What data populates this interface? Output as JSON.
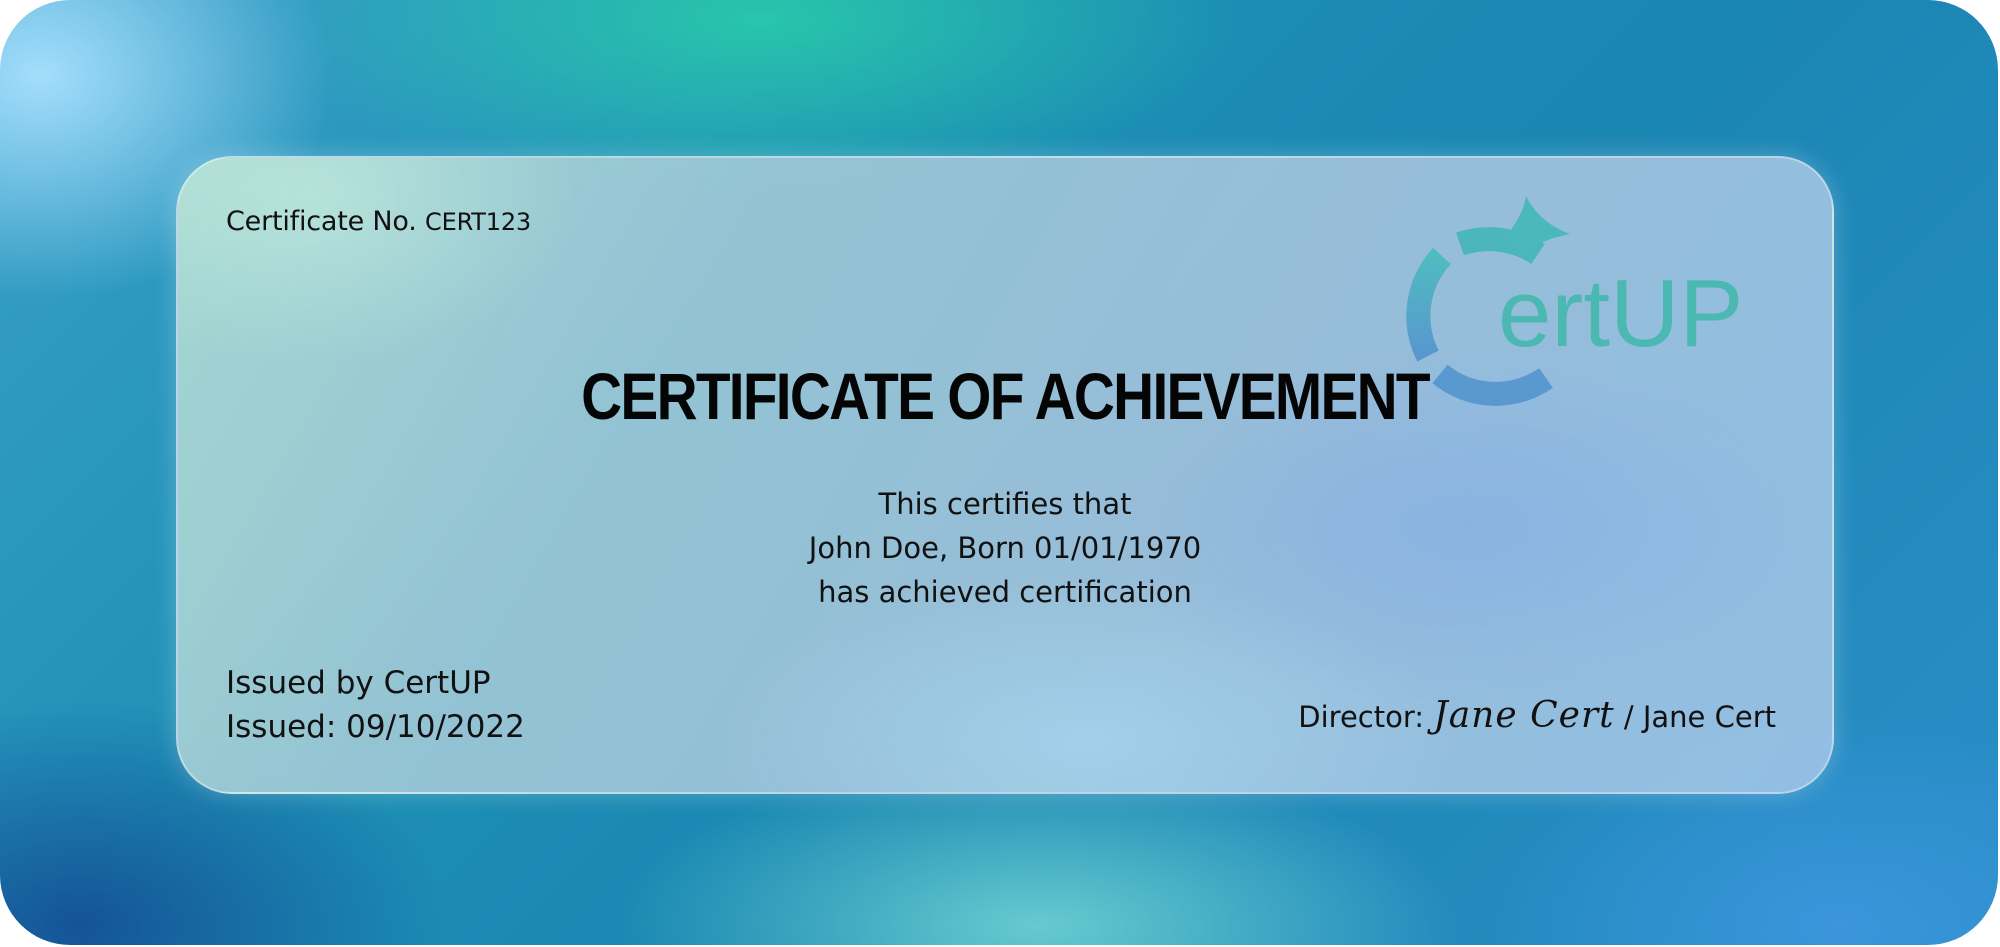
{
  "certificate": {
    "number_label": "Certificate No.",
    "number_value": "CERT123",
    "title": "CERTIFICATE OF ACHIEVEMENT",
    "line1": "This certifies that",
    "line2": "John Doe, Born 01/01/1970",
    "line3": "has achieved certification",
    "issued_by": "Issued by CertUP",
    "issued_date": "Issued: 09/10/2022",
    "director_label": "Director:",
    "director_signature": "Jane Cert",
    "director_separator": "/",
    "director_name": "Jane Cert"
  },
  "logo": {
    "text": "ertUP",
    "icon": "certup-logo-icon",
    "text_color": "#4bb8b2",
    "ring_color_top": "#52b8c8",
    "ring_color_bottom": "#5a9ad0"
  },
  "colors": {
    "background_start": "#3aa0c8",
    "background_end": "#2a8ec8",
    "card": "#a8cad8",
    "text": "#111111"
  }
}
